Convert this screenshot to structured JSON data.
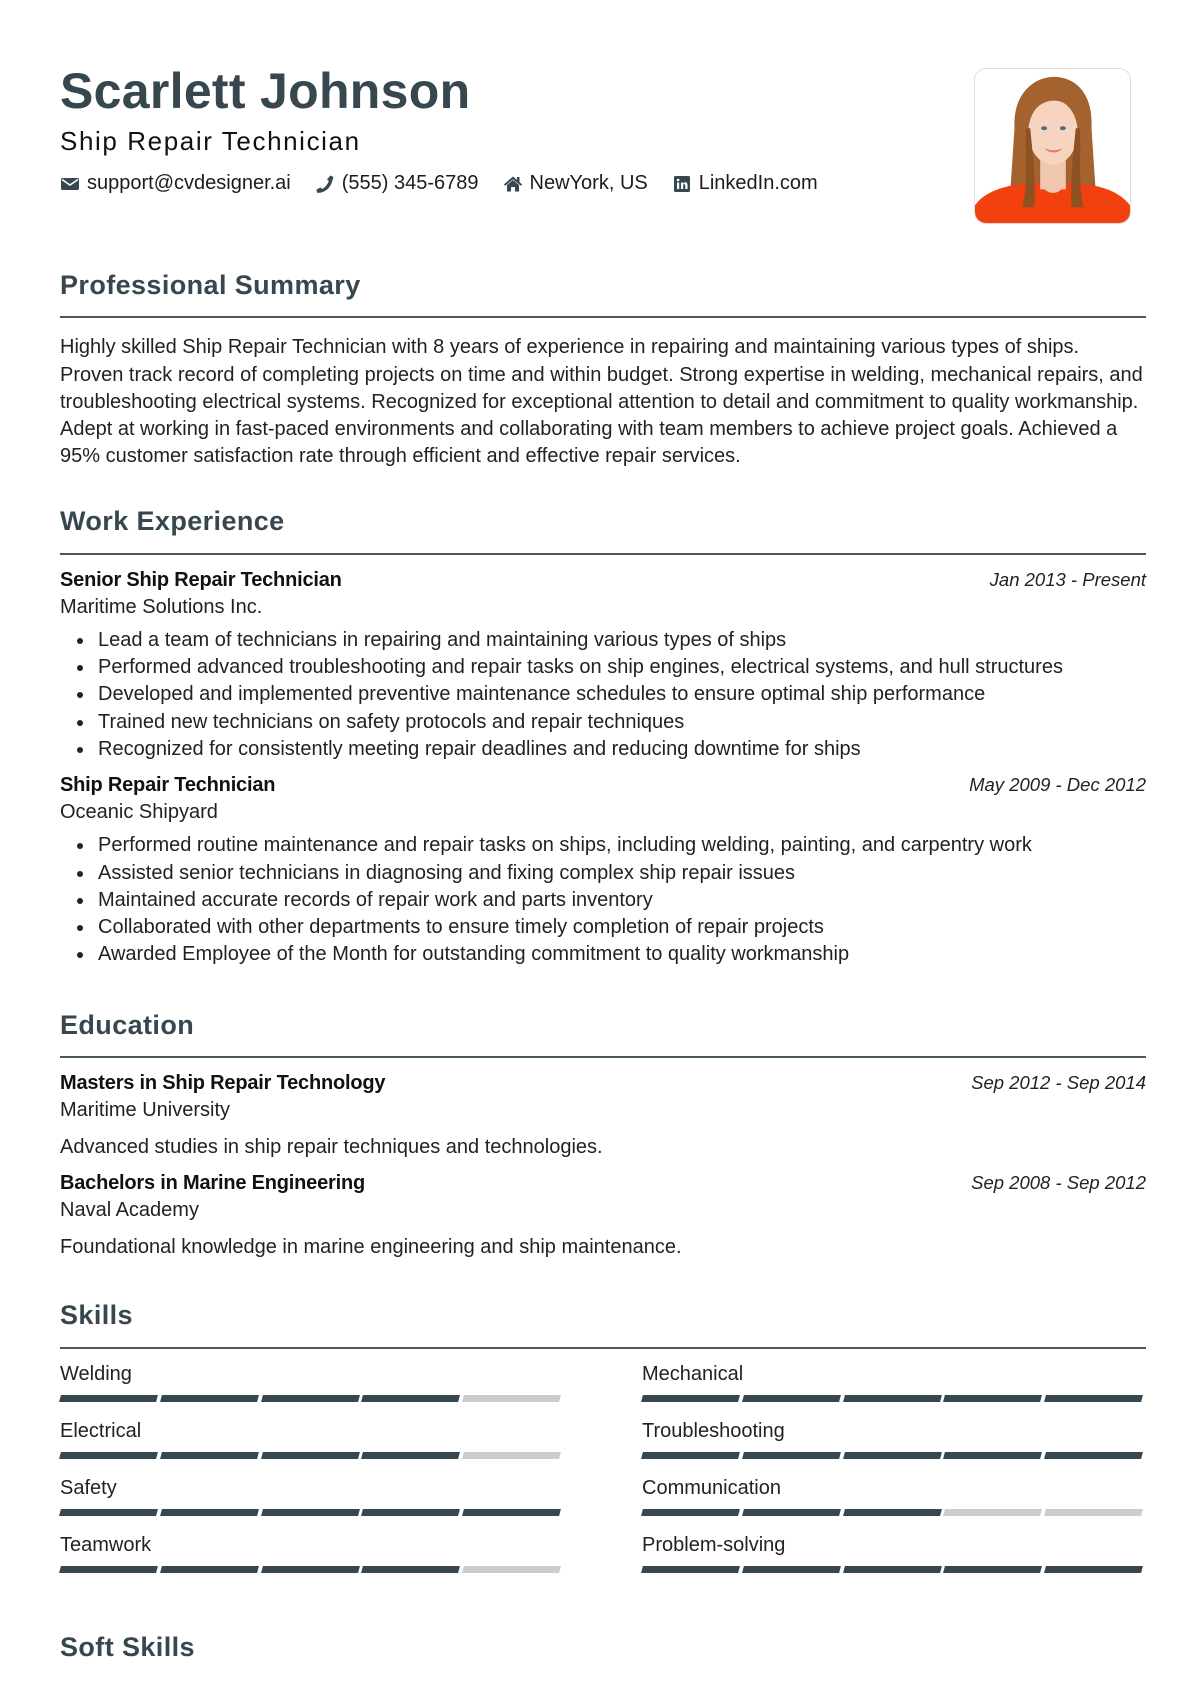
{
  "header": {
    "name": "Scarlett Johnson",
    "title": "Ship Repair Technician",
    "contacts": [
      {
        "icon": "envelope-icon",
        "text": "support@cvdesigner.ai"
      },
      {
        "icon": "phone-icon",
        "text": "(555) 345-6789"
      },
      {
        "icon": "home-icon",
        "text": "NewYork, US"
      },
      {
        "icon": "linkedin-icon",
        "text": "LinkedIn.com"
      }
    ],
    "photo_alt": "Profile photo"
  },
  "summary": {
    "heading": "Professional Summary",
    "text": "Highly skilled Ship Repair Technician with 8 years of experience in repairing and maintaining various types of ships. Proven track record of completing projects on time and within budget. Strong expertise in welding, mechanical repairs, and troubleshooting electrical systems. Recognized for exceptional attention to detail and commitment to quality workmanship. Adept at working in fast-paced environments and collaborating with team members to achieve project goals. Achieved a 95% customer satisfaction rate through efficient and effective repair services."
  },
  "experience": {
    "heading": "Work Experience",
    "jobs": [
      {
        "title": "Senior Ship Repair Technician",
        "company": "Maritime Solutions Inc.",
        "dates": "Jan 2013 - Present",
        "bullets": [
          "Lead a team of technicians in repairing and maintaining various types of ships",
          "Performed advanced troubleshooting and repair tasks on ship engines, electrical systems, and hull structures",
          "Developed and implemented preventive maintenance schedules to ensure optimal ship performance",
          "Trained new technicians on safety protocols and repair techniques",
          "Recognized for consistently meeting repair deadlines and reducing downtime for ships"
        ]
      },
      {
        "title": "Ship Repair Technician",
        "company": "Oceanic Shipyard",
        "dates": "May 2009 - Dec 2012",
        "bullets": [
          "Performed routine maintenance and repair tasks on ships, including welding, painting, and carpentry work",
          "Assisted senior technicians in diagnosing and fixing complex ship repair issues",
          "Maintained accurate records of repair work and parts inventory",
          "Collaborated with other departments to ensure timely completion of repair projects",
          "Awarded Employee of the Month for outstanding commitment to quality workmanship"
        ]
      }
    ]
  },
  "education": {
    "heading": "Education",
    "items": [
      {
        "degree": "Masters in Ship Repair Technology",
        "school": "Maritime University",
        "dates": "Sep 2012 - Sep 2014",
        "description": "Advanced studies in ship repair techniques and technologies."
      },
      {
        "degree": "Bachelors in Marine Engineering",
        "school": "Naval Academy",
        "dates": "Sep 2008 - Sep 2012",
        "description": "Foundational knowledge in marine engineering and ship maintenance."
      }
    ]
  },
  "skills": {
    "heading": "Skills",
    "max_level": 5,
    "items": [
      {
        "name": "Welding",
        "level": 4
      },
      {
        "name": "Mechanical",
        "level": 5
      },
      {
        "name": "Electrical",
        "level": 4
      },
      {
        "name": "Troubleshooting",
        "level": 5
      },
      {
        "name": "Safety",
        "level": 5
      },
      {
        "name": "Communication",
        "level": 3
      },
      {
        "name": "Teamwork",
        "level": 4
      },
      {
        "name": "Problem-solving",
        "level": 5
      }
    ]
  },
  "soft_skills": {
    "heading": "Soft Skills"
  },
  "colors": {
    "accent": "#37474f",
    "bar_empty": "#cccccc",
    "divider": "#4a5862"
  }
}
